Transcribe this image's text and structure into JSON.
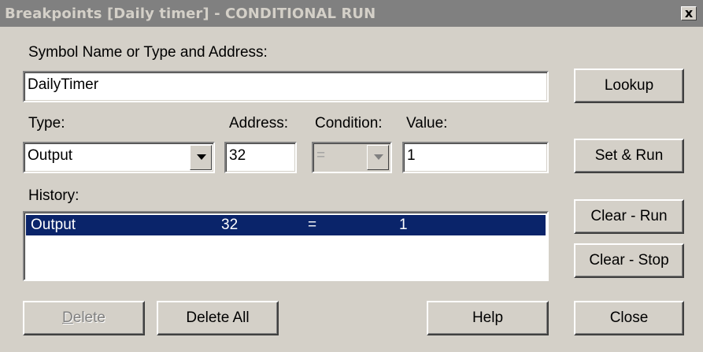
{
  "window": {
    "title": "Breakpoints [Daily timer] - CONDITIONAL RUN",
    "close_glyph": "x"
  },
  "symbol": {
    "label": "Symbol Name or Type and Address:",
    "value": "DailyTimer"
  },
  "type": {
    "label": "Type:",
    "value": "Output"
  },
  "address": {
    "label": "Address:",
    "value": "32"
  },
  "condition": {
    "label": "Condition:",
    "value": "="
  },
  "value": {
    "label": "Value:",
    "value": "1"
  },
  "history": {
    "label": "History:",
    "rows": [
      {
        "type": "Output",
        "address": "32",
        "condition": "=",
        "value": "1"
      }
    ]
  },
  "buttons": {
    "lookup": "Lookup",
    "set_run": "Set & Run",
    "clear_run": "Clear - Run",
    "clear_stop": "Clear - Stop",
    "delete_accel": "D",
    "delete_rest": "elete",
    "delete_all": "Delete All",
    "help": "Help",
    "close": "Close"
  },
  "colors": {
    "selection": "#0a246a",
    "face": "#d4d0c8",
    "titlebar_inactive": "#808080"
  }
}
